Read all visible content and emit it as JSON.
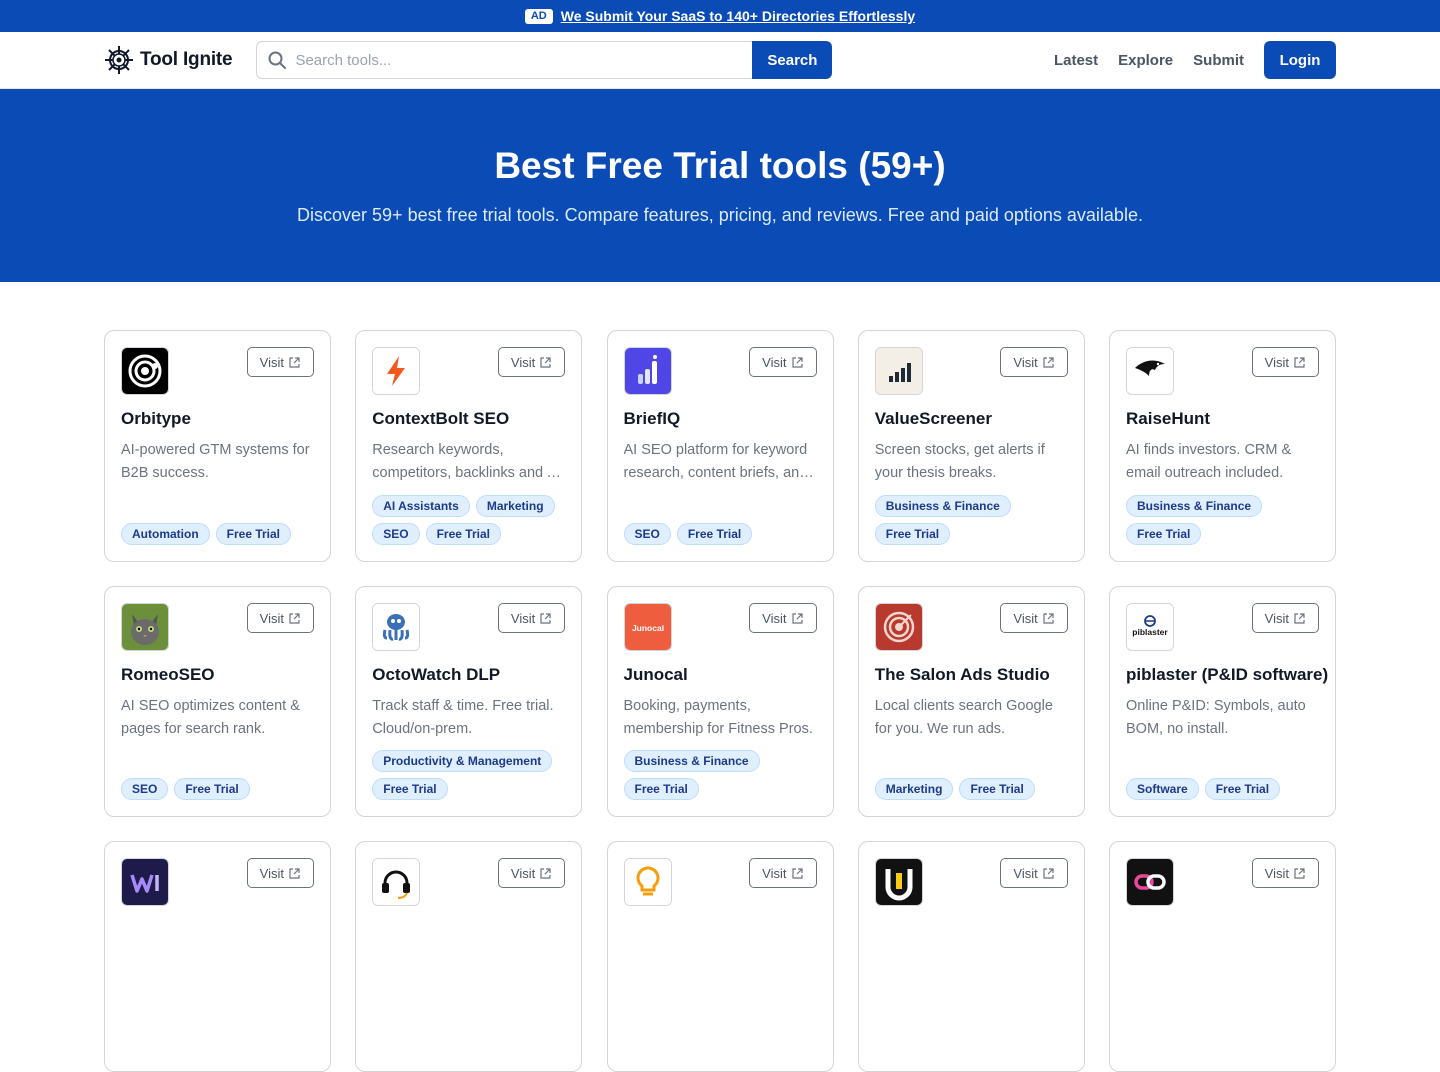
{
  "ad": {
    "badge": "AD",
    "text": "We Submit Your SaaS to 140+ Directories Effortlessly"
  },
  "nav": {
    "brand": "Tool Ignite",
    "search_placeholder": "Search tools...",
    "search_button": "Search",
    "links": [
      "Latest",
      "Explore",
      "Submit"
    ],
    "login": "Login"
  },
  "hero": {
    "title": "Best Free Trial tools (59+)",
    "subtitle": "Discover 59+ best free trial tools. Compare features, pricing, and reviews. Free and paid options available."
  },
  "visit_label": "Visit",
  "tools": [
    {
      "name": "Orbitype",
      "desc": "AI-powered GTM systems for B2B success.",
      "tags": [
        "Automation",
        "Free Trial"
      ],
      "icon": "orbit-icon"
    },
    {
      "name": "ContextBolt SEO",
      "desc": "Research keywords, competitors, backlinks and AI visibility.",
      "tags": [
        "AI Assistants",
        "Marketing",
        "SEO",
        "Free Trial"
      ],
      "icon": "bolt-icon"
    },
    {
      "name": "BriefIQ",
      "desc": "AI SEO platform for keyword research, content briefs, and more.",
      "tags": [
        "SEO",
        "Free Trial"
      ],
      "icon": "bar-chart-icon"
    },
    {
      "name": "ValueScreener",
      "desc": "Screen stocks, get alerts if your thesis breaks.",
      "tags": [
        "Business & Finance",
        "Free Trial"
      ],
      "icon": "signal-bars-icon"
    },
    {
      "name": "RaiseHunt",
      "desc": "AI finds investors. CRM & email outreach included.",
      "tags": [
        "Business & Finance",
        "Free Trial"
      ],
      "icon": "eagle-icon"
    },
    {
      "name": "RomeoSEO",
      "desc": "AI SEO optimizes content & pages for search rank.",
      "tags": [
        "SEO",
        "Free Trial"
      ],
      "icon": "cat-icon"
    },
    {
      "name": "OctoWatch DLP",
      "desc": "Track staff & time. Free trial. Cloud/on-prem.",
      "tags": [
        "Productivity & Management",
        "Free Trial"
      ],
      "icon": "octopus-icon"
    },
    {
      "name": "Junocal",
      "desc": "Booking, payments, membership for Fitness Pros.",
      "tags": [
        "Business & Finance",
        "Free Trial"
      ],
      "icon": "junocal-logo-icon",
      "logo_text": "Junocal"
    },
    {
      "name": "The Salon Ads Studio",
      "desc": "Local clients search Google for you. We run ads.",
      "tags": [
        "Marketing",
        "Free Trial"
      ],
      "icon": "target-icon"
    },
    {
      "name": "piblaster (P&ID software)",
      "desc": "Online P&ID: Symbols, auto BOM, no install.",
      "tags": [
        "Software",
        "Free Trial"
      ],
      "icon": "piblaster-logo-icon",
      "logo_text": "piblaster"
    },
    {
      "name": "",
      "desc": "",
      "tags": [],
      "icon": "wi-logo-icon"
    },
    {
      "name": "",
      "desc": "",
      "tags": [],
      "icon": "headset-icon"
    },
    {
      "name": "",
      "desc": "",
      "tags": [],
      "icon": "lightbulb-icon"
    },
    {
      "name": "",
      "desc": "",
      "tags": [],
      "icon": "u-logo-icon"
    },
    {
      "name": "",
      "desc": "",
      "tags": [],
      "icon": "link-icon"
    }
  ],
  "colors": {
    "primary": "#0a4bb5",
    "tag_bg": "#e0effe",
    "tag_text": "#1e3a8a"
  }
}
